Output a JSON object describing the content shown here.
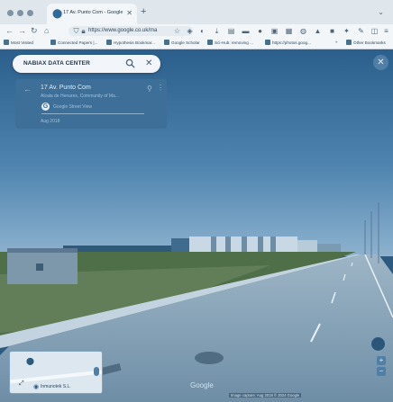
{
  "browser": {
    "tab_title": "17 Av. Punto Com - Google Maps",
    "url": "https://www.google.co.uk/ma",
    "bookmarks": [
      "Most Visited",
      "Connected Papers |...",
      "Hypothesis Bookmar...",
      "Google Scholar",
      "Sci-Hub: removing ...",
      "https://photos.goog..."
    ],
    "other_bookmarks": "Other Bookmarks"
  },
  "maps": {
    "search_value": "NABIAX DATA CENTER",
    "place_title": "17 Av. Punto Com",
    "place_subtitle": "Alcala de Henares, Community of Ma...",
    "imagery_source": "Google Street View",
    "capture_date_short": "Aug 2018",
    "google_logo": "Google",
    "attribution": "Image capture: Aug 2018  © 2024 Google",
    "minimap_label": "Inmunotek S.L.",
    "zoom_in": "+",
    "zoom_out": "−"
  },
  "colors": {
    "accent": "#3d6f98",
    "tint": "#2d5a80"
  }
}
